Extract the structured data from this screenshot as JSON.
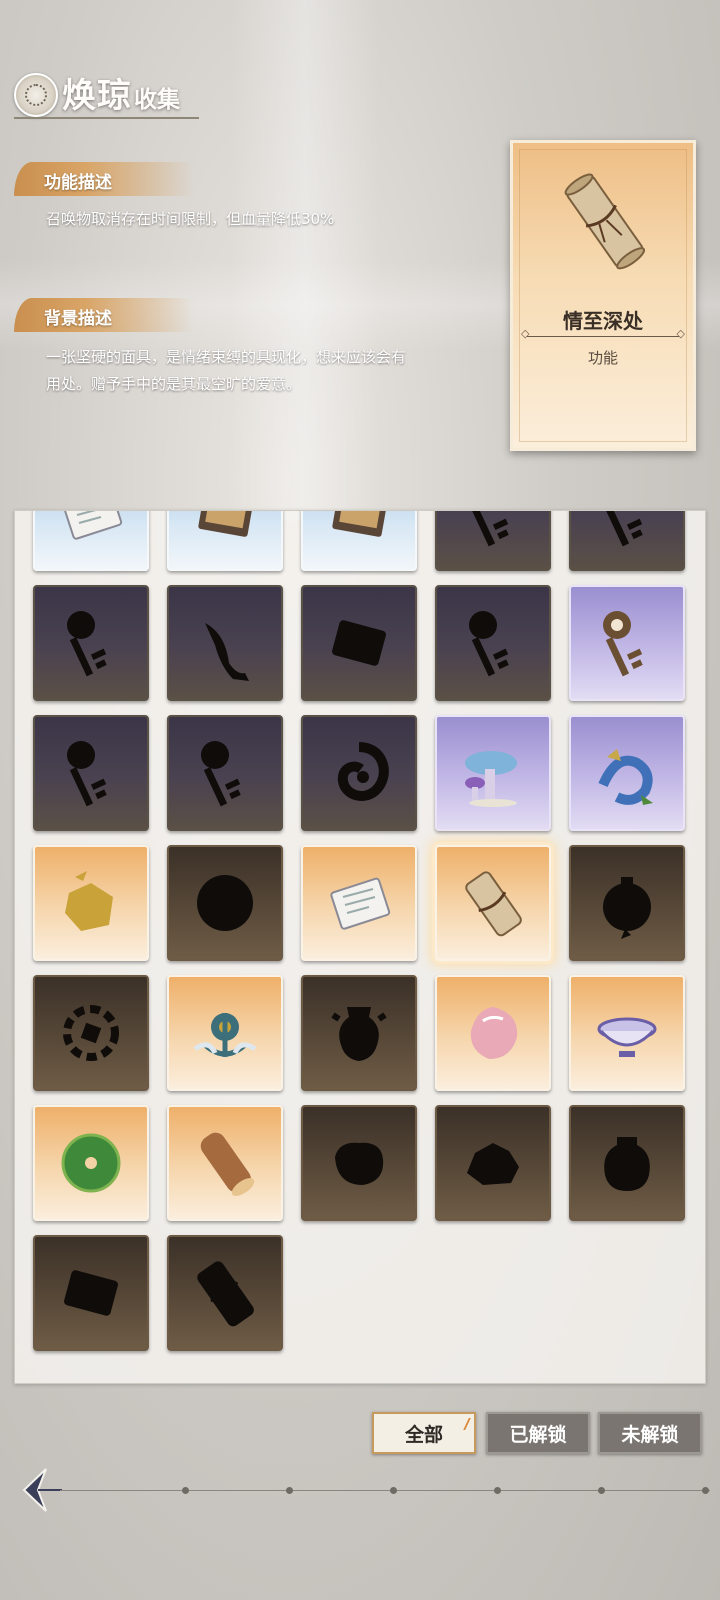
{
  "header": {
    "title_main": "焕琼",
    "title_sub": "收集"
  },
  "function_section": {
    "heading": "功能描述",
    "text": "召唤物取消存在时间限制，但血量降低30%"
  },
  "background_section": {
    "heading": "背景描述",
    "text": "一张坚硬的面具，是情绪束缚的具现化，想来应该会有用处。赠予手中的是其最空旷的爱意。"
  },
  "detail_card": {
    "name": "情至深处",
    "type": "功能",
    "icon": "scroll-icon"
  },
  "grid": {
    "items": [
      {
        "style": "blue",
        "icon": "letter-icon"
      },
      {
        "style": "blue",
        "icon": "book-icon"
      },
      {
        "style": "blue",
        "icon": "book-icon"
      },
      {
        "style": "locked-dark",
        "icon": "key-icon"
      },
      {
        "style": "locked-dark",
        "icon": "key-icon"
      },
      {
        "style": "locked-dark",
        "icon": "key-icon"
      },
      {
        "style": "locked-dark",
        "icon": "fish-icon"
      },
      {
        "style": "locked-dark",
        "icon": "paper-icon"
      },
      {
        "style": "locked-dark",
        "icon": "key-icon"
      },
      {
        "style": "purple",
        "icon": "key-icon"
      },
      {
        "style": "locked-dark",
        "icon": "key-icon"
      },
      {
        "style": "locked-dark",
        "icon": "key-icon"
      },
      {
        "style": "locked-dark",
        "icon": "swirl-icon"
      },
      {
        "style": "purple",
        "icon": "mushroom-icon"
      },
      {
        "style": "purple",
        "icon": "dragon-icon"
      },
      {
        "style": "gold",
        "icon": "gold-ore-icon"
      },
      {
        "style": "locked-brown",
        "icon": "orb-icon"
      },
      {
        "style": "gold",
        "icon": "letter-icon"
      },
      {
        "style": "gold",
        "icon": "scroll-icon",
        "selected": true
      },
      {
        "style": "locked-brown",
        "icon": "bomb-icon"
      },
      {
        "style": "locked-brown",
        "icon": "gear-icon"
      },
      {
        "style": "gold",
        "icon": "anchor-icon"
      },
      {
        "style": "locked-brown",
        "icon": "vase-icon"
      },
      {
        "style": "gold",
        "icon": "gem-icon"
      },
      {
        "style": "gold",
        "icon": "bowl-icon"
      },
      {
        "style": "gold",
        "icon": "jade-disc-icon"
      },
      {
        "style": "gold",
        "icon": "log-icon"
      },
      {
        "style": "locked-brown",
        "icon": "rock-icon"
      },
      {
        "style": "locked-brown",
        "icon": "ore-icon"
      },
      {
        "style": "locked-brown",
        "icon": "jar-icon"
      },
      {
        "style": "locked-brown",
        "icon": "paper-icon"
      },
      {
        "style": "locked-brown",
        "icon": "scroll-icon"
      }
    ]
  },
  "filters": {
    "all": "全部",
    "unlocked": "已解锁",
    "locked": "未解锁"
  },
  "colors": {
    "accent": "#d9a567",
    "gold_tile": "#eeb06a",
    "purple_tile": "#9a8fd0",
    "blue_tile": "#9cc4e6",
    "locked_tile": "#3b3548"
  }
}
